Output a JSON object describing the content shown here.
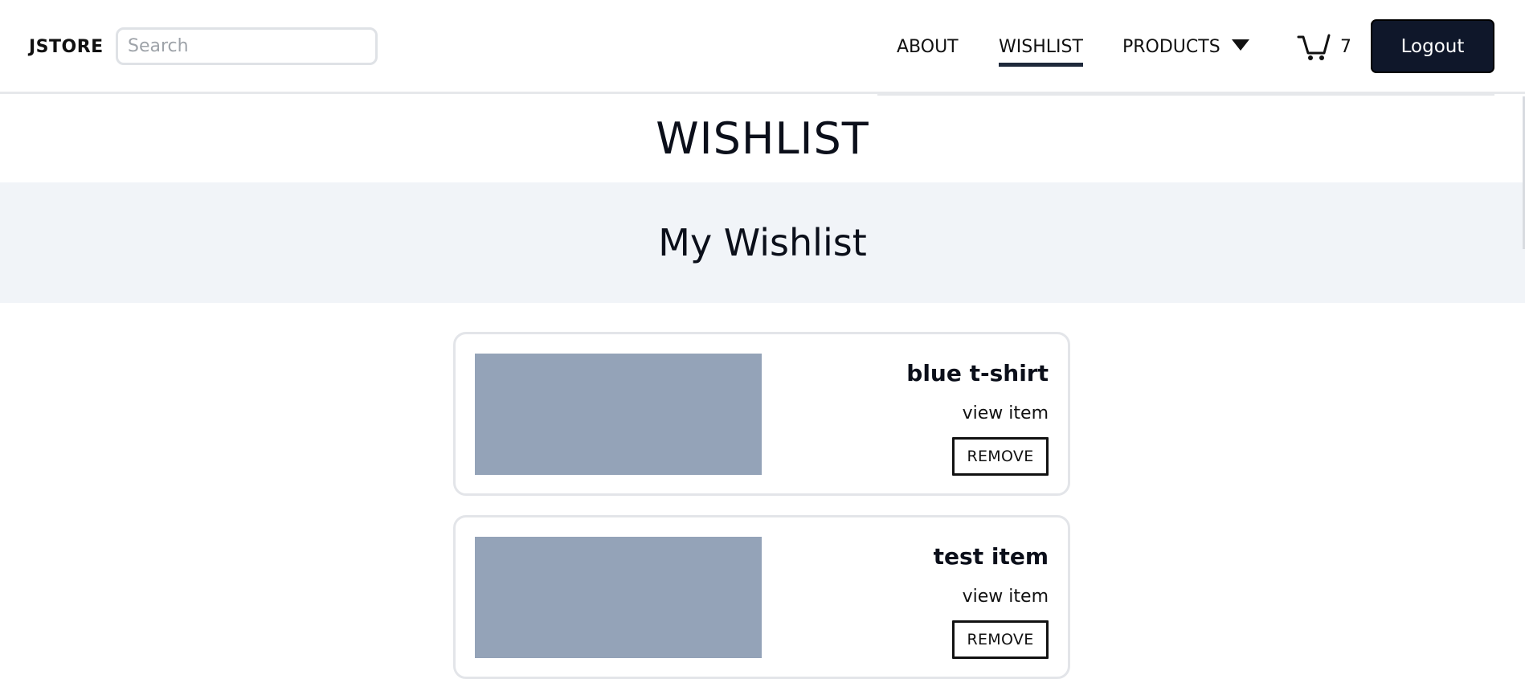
{
  "nav": {
    "brand": "JSTORE",
    "search_placeholder": "Search",
    "links": {
      "about": "ABOUT",
      "wishlist": "WISHLIST",
      "products": "PRODUCTS"
    },
    "cart_count": "7",
    "logout_label": "Logout"
  },
  "page": {
    "title": "WISHLIST",
    "hero_title": "My Wishlist"
  },
  "wishlist_items": [
    {
      "name": "blue t-shirt",
      "link_label": "view item",
      "remove_label": "REMOVE"
    },
    {
      "name": "test item",
      "link_label": "view item",
      "remove_label": "REMOVE"
    }
  ],
  "colors": {
    "accent": "#0f172a",
    "image_placeholder": "#94a3b8",
    "hero_background": "#f1f4f8",
    "active_underline": "#1e293b"
  },
  "icons": {
    "cart": "cart-icon",
    "products_dropdown": "chevron-down-icon"
  }
}
